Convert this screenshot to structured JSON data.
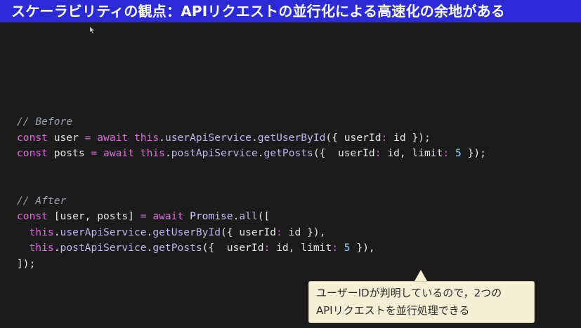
{
  "slide": {
    "title": "スケーラビリティの観点：APIリクエストの並行化による高速化の余地がある",
    "title_bar_color": "#2b2bd6"
  },
  "code": {
    "lines": [
      [
        {
          "t": "comment",
          "v": "// Before"
        }
      ],
      [
        {
          "t": "keyword",
          "v": "const"
        },
        {
          "t": "ident",
          "v": " user "
        },
        {
          "t": "op",
          "v": "="
        },
        {
          "t": "ident",
          "v": " "
        },
        {
          "t": "keyword",
          "v": "await"
        },
        {
          "t": "ident",
          "v": " "
        },
        {
          "t": "keyword",
          "v": "this"
        },
        {
          "t": "punct",
          "v": "."
        },
        {
          "t": "method",
          "v": "userApiService"
        },
        {
          "t": "punct",
          "v": "."
        },
        {
          "t": "method",
          "v": "getUserById"
        },
        {
          "t": "punct",
          "v": "({ userId"
        },
        {
          "t": "op",
          "v": ":"
        },
        {
          "t": "ident",
          "v": " id "
        },
        {
          "t": "punct",
          "v": "});"
        }
      ],
      [
        {
          "t": "keyword",
          "v": "const"
        },
        {
          "t": "ident",
          "v": " posts "
        },
        {
          "t": "op",
          "v": "="
        },
        {
          "t": "ident",
          "v": " "
        },
        {
          "t": "keyword",
          "v": "await"
        },
        {
          "t": "ident",
          "v": " "
        },
        {
          "t": "keyword",
          "v": "this"
        },
        {
          "t": "punct",
          "v": "."
        },
        {
          "t": "method",
          "v": "postApiService"
        },
        {
          "t": "punct",
          "v": "."
        },
        {
          "t": "method",
          "v": "getPosts"
        },
        {
          "t": "punct",
          "v": "({  userId"
        },
        {
          "t": "op",
          "v": ":"
        },
        {
          "t": "ident",
          "v": " id, limit"
        },
        {
          "t": "op",
          "v": ":"
        },
        {
          "t": "ident",
          "v": " "
        },
        {
          "t": "number",
          "v": "5"
        },
        {
          "t": "punct",
          "v": " });"
        }
      ],
      [],
      [],
      [
        {
          "t": "comment",
          "v": "// After"
        }
      ],
      [
        {
          "t": "keyword",
          "v": "const"
        },
        {
          "t": "ident",
          "v": " [user, posts] "
        },
        {
          "t": "op",
          "v": "="
        },
        {
          "t": "ident",
          "v": " "
        },
        {
          "t": "keyword",
          "v": "await"
        },
        {
          "t": "ident",
          "v": " "
        },
        {
          "t": "class",
          "v": "Promise"
        },
        {
          "t": "punct",
          "v": "."
        },
        {
          "t": "method",
          "v": "all"
        },
        {
          "t": "punct",
          "v": "(["
        }
      ],
      [
        {
          "t": "ident",
          "v": "  "
        },
        {
          "t": "keyword",
          "v": "this"
        },
        {
          "t": "punct",
          "v": "."
        },
        {
          "t": "method",
          "v": "userApiService"
        },
        {
          "t": "punct",
          "v": "."
        },
        {
          "t": "method",
          "v": "getUserById"
        },
        {
          "t": "punct",
          "v": "({ userId"
        },
        {
          "t": "op",
          "v": ":"
        },
        {
          "t": "ident",
          "v": " id "
        },
        {
          "t": "punct",
          "v": "}),"
        }
      ],
      [
        {
          "t": "ident",
          "v": "  "
        },
        {
          "t": "keyword",
          "v": "this"
        },
        {
          "t": "punct",
          "v": "."
        },
        {
          "t": "method",
          "v": "postApiService"
        },
        {
          "t": "punct",
          "v": "."
        },
        {
          "t": "method",
          "v": "getPosts"
        },
        {
          "t": "punct",
          "v": "({  userId"
        },
        {
          "t": "op",
          "v": ":"
        },
        {
          "t": "ident",
          "v": " id, limit"
        },
        {
          "t": "op",
          "v": ":"
        },
        {
          "t": "ident",
          "v": " "
        },
        {
          "t": "number",
          "v": "5"
        },
        {
          "t": "punct",
          "v": " }),"
        }
      ],
      [
        {
          "t": "punct",
          "v": "]);"
        }
      ]
    ]
  },
  "callout": {
    "line1": "ユーザーIDが判明しているので，2つの",
    "line2": "APIリクエストを並行処理できる",
    "background": "#f6efd3"
  },
  "colors": {
    "background": "#1b1b1b",
    "keyword": "#e06ce0",
    "method": "#bfb6f0",
    "number": "#8fd3ff",
    "comment": "#9da3ab"
  }
}
